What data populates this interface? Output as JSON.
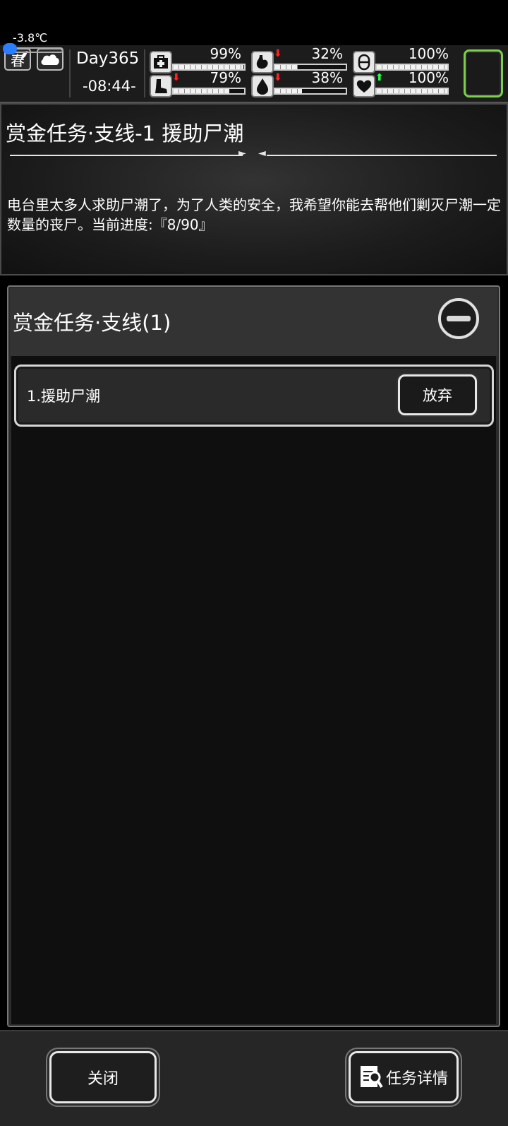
{
  "status": {
    "season": "春",
    "temperature": "-3.8℃",
    "day": "Day365",
    "time": "-08:44-",
    "stats": [
      {
        "icon": "medkit-icon",
        "percent": "99%",
        "level": 0.99,
        "trend": ""
      },
      {
        "icon": "stomach-icon",
        "percent": "32%",
        "level": 0.32,
        "trend": "down"
      },
      {
        "icon": "capsule-icon",
        "percent": "100%",
        "level": 1.0,
        "trend": ""
      },
      {
        "icon": "boot-icon",
        "percent": "79%",
        "level": 0.79,
        "trend": "down"
      },
      {
        "icon": "water-drop-icon",
        "percent": "38%",
        "level": 0.38,
        "trend": "down"
      },
      {
        "icon": "heart-icon",
        "percent": "100%",
        "level": 1.0,
        "trend": "up"
      }
    ],
    "slot_color": "#7ad04a"
  },
  "task": {
    "title": "赏金任务·支线-1 援助尸潮",
    "description": "电台里太多人求助尸潮了，为了人类的安全，我希望你能去帮他们剿灭尸潮一定数量的丧尸。当前进度:『8/90』"
  },
  "list": {
    "title": "赏金任务·支线(1)",
    "items": [
      {
        "label": "1.援助尸潮",
        "action": "放弃"
      }
    ]
  },
  "footer": {
    "close": "关闭",
    "details": "任务详情"
  }
}
